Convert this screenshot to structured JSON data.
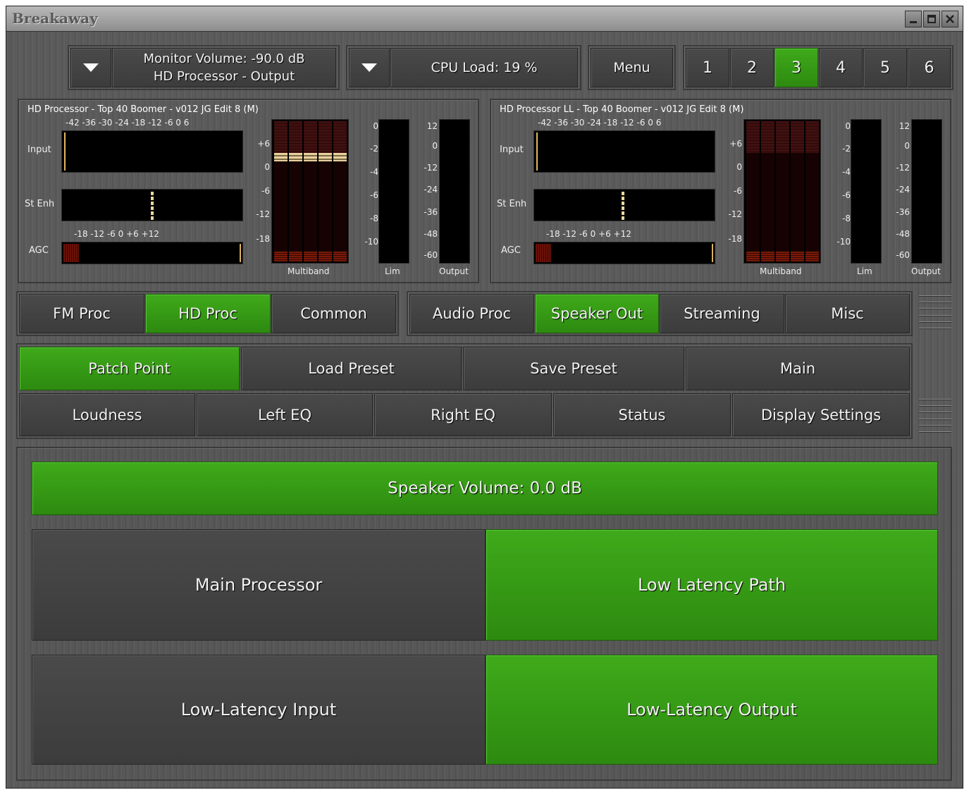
{
  "window": {
    "title": "Breakaway"
  },
  "topbar": {
    "monitor_line1": "Monitor Volume: -90.0 dB",
    "monitor_line2": "HD Processor - Output",
    "cpu": "CPU Load: 19 %",
    "menu": "Menu",
    "presets": [
      "1",
      "2",
      "3",
      "4",
      "5",
      "6"
    ],
    "active_preset": "3"
  },
  "left_meters": {
    "title": "HD Processor - Top 40 Boomer - v012 JG Edit 8 (M)",
    "input_label": "Input",
    "stenh_label": "St Enh",
    "agc_label": "AGC",
    "input_scale": "-42 -36 -30 -24 -18 -12  -6   0   6",
    "agc_scale": "-18   -12    -6     0   +6  +12",
    "mb_scale": [
      "+6",
      "0",
      "-6",
      "-12",
      "-18"
    ],
    "lim_scale": [
      "0",
      "-2",
      "-4",
      "-6",
      "-8",
      "-10"
    ],
    "out_scale": [
      "12",
      "0",
      "-12",
      "-24",
      "-36",
      "-48",
      "-60"
    ],
    "multiband_label": "Multiband",
    "lim_label": "Lim",
    "output_label": "Output"
  },
  "right_meters": {
    "title": "HD Processor LL - Top 40 Boomer - v012 JG Edit 8 (M)",
    "input_label": "Input",
    "stenh_label": "St Enh",
    "agc_label": "AGC",
    "input_scale": "-42 -36 -30 -24 -18 -12  -6   0   6",
    "agc_scale": "-18   -12    -6     0   +6  +12",
    "mb_scale": [
      "+6",
      "0",
      "-6",
      "-12",
      "-18"
    ],
    "lim_scale": [
      "0",
      "-2",
      "-4",
      "-6",
      "-8",
      "-10"
    ],
    "out_scale": [
      "12",
      "0",
      "-12",
      "-24",
      "-36",
      "-48",
      "-60"
    ],
    "multiband_label": "Multiband",
    "lim_label": "Lim",
    "output_label": "Output"
  },
  "tabs_left": [
    "FM Proc",
    "HD Proc",
    "Common"
  ],
  "tabs_left_active": "HD Proc",
  "tabs_right": [
    "Audio Proc",
    "Speaker Out",
    "Streaming",
    "Misc"
  ],
  "tabs_right_active": "Speaker Out",
  "subtabs_row1": [
    "Patch Point",
    "Load Preset",
    "Save Preset",
    "Main"
  ],
  "subtabs_row1_active": "Patch Point",
  "subtabs_row2": [
    "Loudness",
    "Left EQ",
    "Right EQ",
    "Status",
    "Display Settings"
  ],
  "content": {
    "speaker_volume": "Speaker Volume: 0.0 dB",
    "main_processor": "Main Processor",
    "low_latency_path": "Low Latency Path",
    "low_latency_input": "Low-Latency Input",
    "low_latency_output": "Low-Latency Output",
    "selected": [
      "Low Latency Path",
      "Low-Latency Output"
    ]
  },
  "colors": {
    "active_green": "#35a014",
    "button_gray": "#434343",
    "meter_black": "#000000"
  }
}
